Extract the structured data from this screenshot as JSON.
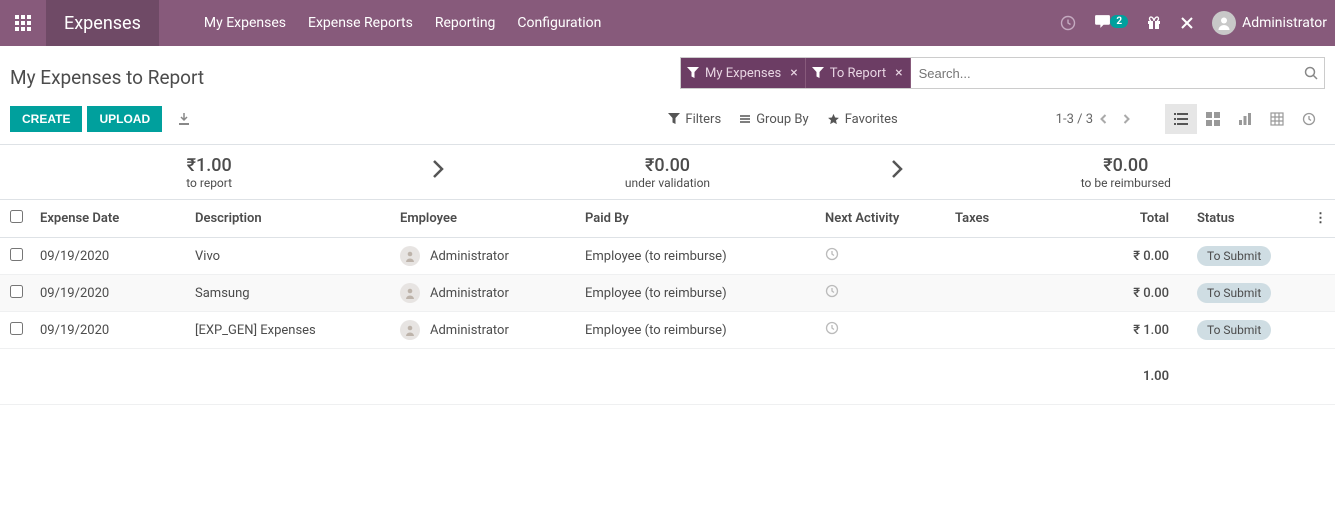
{
  "topbar": {
    "app_name": "Expenses",
    "nav": [
      "My Expenses",
      "Expense Reports",
      "Reporting",
      "Configuration"
    ],
    "msg_badge": "2",
    "user": "Administrator"
  },
  "header": {
    "title": "My Expenses to Report",
    "filter_chips": [
      "My Expenses",
      "To Report"
    ],
    "search_placeholder": "Search...",
    "create_btn": "CREATE",
    "upload_btn": "UPLOAD",
    "filters_label": "Filters",
    "groupby_label": "Group By",
    "favorites_label": "Favorites",
    "pager": "1-3 / 3"
  },
  "summary": {
    "to_report_amount": "₹1.00",
    "to_report_label": "to report",
    "under_validation_amount": "₹0.00",
    "under_validation_label": "under validation",
    "to_reimburse_amount": "₹0.00",
    "to_reimburse_label": "to be reimbursed"
  },
  "columns": {
    "date": "Expense Date",
    "description": "Description",
    "employee": "Employee",
    "paid_by": "Paid By",
    "next_activity": "Next Activity",
    "taxes": "Taxes",
    "total": "Total",
    "status": "Status"
  },
  "rows": [
    {
      "date": "09/19/2020",
      "description": "Vivo",
      "employee": "Administrator",
      "paid_by": "Employee (to reimburse)",
      "total": "₹ 0.00",
      "status": "To Submit"
    },
    {
      "date": "09/19/2020",
      "description": "Samsung",
      "employee": "Administrator",
      "paid_by": "Employee (to reimburse)",
      "total": "₹ 0.00",
      "status": "To Submit"
    },
    {
      "date": "09/19/2020",
      "description": "[EXP_GEN] Expenses",
      "employee": "Administrator",
      "paid_by": "Employee (to reimburse)",
      "total": "₹ 1.00",
      "status": "To Submit"
    }
  ],
  "footer": {
    "total": "1.00"
  }
}
